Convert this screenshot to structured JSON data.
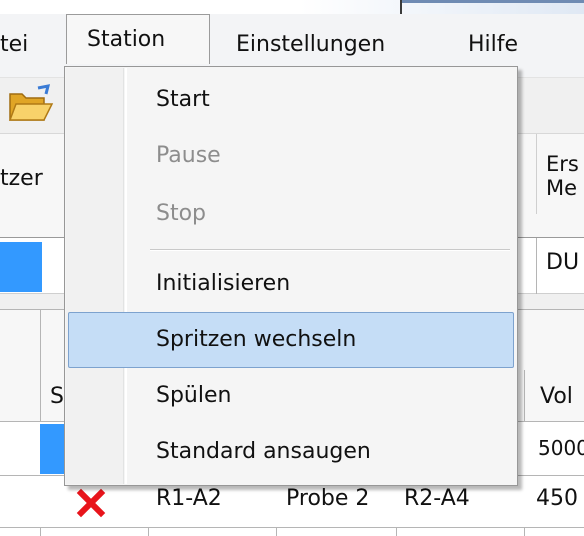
{
  "menubar": {
    "file_partial": "tei",
    "station": "Station",
    "settings": "Einstellungen",
    "help": "Hilfe"
  },
  "dropdown": {
    "items": [
      {
        "label": "Start",
        "enabled": true
      },
      {
        "label": "Pause",
        "enabled": false
      },
      {
        "label": "Stop",
        "enabled": false
      },
      {
        "label": "Initialisieren",
        "enabled": true
      },
      {
        "label": "Spritzen wechseln",
        "enabled": true,
        "highlighted": true
      },
      {
        "label": "Spülen",
        "enabled": true
      },
      {
        "label": "Standard ansaugen",
        "enabled": true
      }
    ]
  },
  "grid_top": {
    "header_user_partial": "tzer",
    "header_col3_line1": "Ers",
    "header_col3_line2": "Me",
    "row1_col3": "DU"
  },
  "grid_bottom": {
    "header_col_s": "S",
    "header_vol": "Vol",
    "row1_vol": "5000",
    "row2": {
      "status_icon": "x-icon",
      "col_a": "R1-A2",
      "col_b": "Probe 2",
      "col_c": "R2-A4",
      "vol": "450"
    }
  },
  "colors": {
    "selection": "#3399ff",
    "highlight_bg": "#c5ddf6",
    "highlight_border": "#7da2ce",
    "error_icon": "#e8141b"
  }
}
